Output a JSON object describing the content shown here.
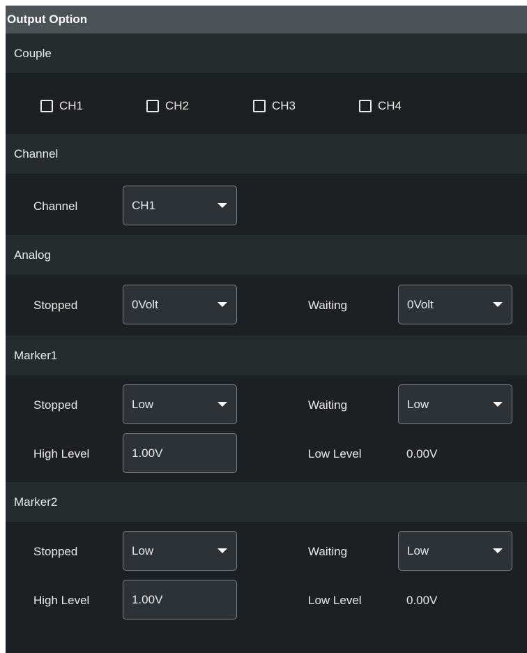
{
  "title": "Output Option",
  "couple": {
    "heading": "Couple",
    "checkboxes": [
      {
        "label": "CH1",
        "checked": false
      },
      {
        "label": "CH2",
        "checked": false
      },
      {
        "label": "CH3",
        "checked": false
      },
      {
        "label": "CH4",
        "checked": false
      }
    ]
  },
  "channel": {
    "heading": "Channel",
    "label": "Channel",
    "value": "CH1"
  },
  "analog": {
    "heading": "Analog",
    "stopped_label": "Stopped",
    "stopped_value": "0Volt",
    "waiting_label": "Waiting",
    "waiting_value": "0Volt"
  },
  "marker1": {
    "heading": "Marker1",
    "stopped_label": "Stopped",
    "stopped_value": "Low",
    "waiting_label": "Waiting",
    "waiting_value": "Low",
    "high_label": "High Level",
    "high_value": "1.00V",
    "low_label": "Low Level",
    "low_value": "0.00V"
  },
  "marker2": {
    "heading": "Marker2",
    "stopped_label": "Stopped",
    "stopped_value": "Low",
    "waiting_label": "Waiting",
    "waiting_value": "Low",
    "high_label": "High Level",
    "high_value": "1.00V",
    "low_label": "Low Level",
    "low_value": "0.00V"
  },
  "icons": [
    "checkbox-icon",
    "chevron-down-icon"
  ]
}
